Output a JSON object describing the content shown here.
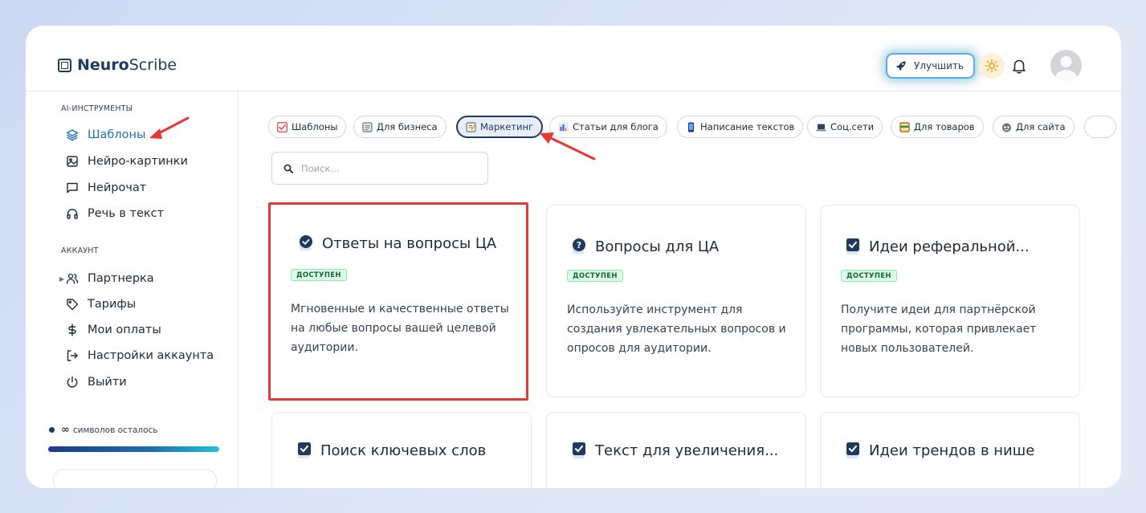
{
  "app": {
    "logo_bold": "Neuro",
    "logo_light": "Scribe"
  },
  "header": {
    "upgrade_label": "Улучшить",
    "icons": [
      "rocket-icon",
      "sun-icon",
      "bell-icon",
      "avatar"
    ]
  },
  "sidebar": {
    "section_tools": "AI-ИНСТРУМЕНТЫ",
    "tools": [
      {
        "label": "Шаблоны",
        "icon": "layers-icon",
        "active": true
      },
      {
        "label": "Нейро-картинки",
        "icon": "image-icon"
      },
      {
        "label": "Нейрочат",
        "icon": "chat-icon"
      },
      {
        "label": "Речь в текст",
        "icon": "headphones-icon"
      }
    ],
    "section_account": "АККАУНТ",
    "account": [
      {
        "label": "Партнерка",
        "icon": "users-icon"
      },
      {
        "label": "Тарифы",
        "icon": "tag-icon"
      },
      {
        "label": "Мои оплаты",
        "icon": "dollar-icon"
      },
      {
        "label": "Настройки аккаунта",
        "icon": "login-icon"
      },
      {
        "label": "Выйти",
        "icon": "power-icon"
      }
    ],
    "chars_symbol": "∞",
    "chars_text": "символов осталось"
  },
  "categories": [
    {
      "label": "Шаблоны",
      "icon_color": "#e25555"
    },
    {
      "label": "Для бизнеса",
      "icon_color": "#6b7280"
    },
    {
      "label": "Маркетинг",
      "icon_color": "#6b7280",
      "active": true
    },
    {
      "label": "Статьи для блога",
      "icon_color": "#7c3aed"
    },
    {
      "label": "Написание текстов",
      "icon_color": "#1e3a5f"
    },
    {
      "label": "Соц.сети",
      "icon_color": "#374151"
    },
    {
      "label": "Для товаров",
      "icon_color": "#c2410c"
    },
    {
      "label": "Для сайта",
      "icon_color": "#1f2937"
    }
  ],
  "search": {
    "placeholder": "Поиск..."
  },
  "cards": [
    {
      "title": "Ответы на вопросы ЦА",
      "badge": "ДОСТУПЕН",
      "description": "Мгновенные и качественные ответы на любые вопросы вашей целевой аудитории.",
      "icon": "check-circle-icon"
    },
    {
      "title": "Вопросы для ЦА",
      "badge": "ДОСТУПЕН",
      "description": "Используйте инструмент для создания увлекательных вопросов и опросов для аудитории.",
      "icon": "question-icon"
    },
    {
      "title": "Идеи реферальной...",
      "badge": "ДОСТУПЕН",
      "description": "Получите идеи для партнёрской программы, которая привлекает новых пользователей.",
      "icon": "checkbox-icon"
    },
    {
      "title": "Поиск ключевых слов",
      "icon": "checkbox-icon"
    },
    {
      "title": "Текст для увеличения...",
      "icon": "checkbox-icon"
    },
    {
      "title": "Идеи трендов в нише",
      "icon": "checkbox-icon"
    }
  ]
}
